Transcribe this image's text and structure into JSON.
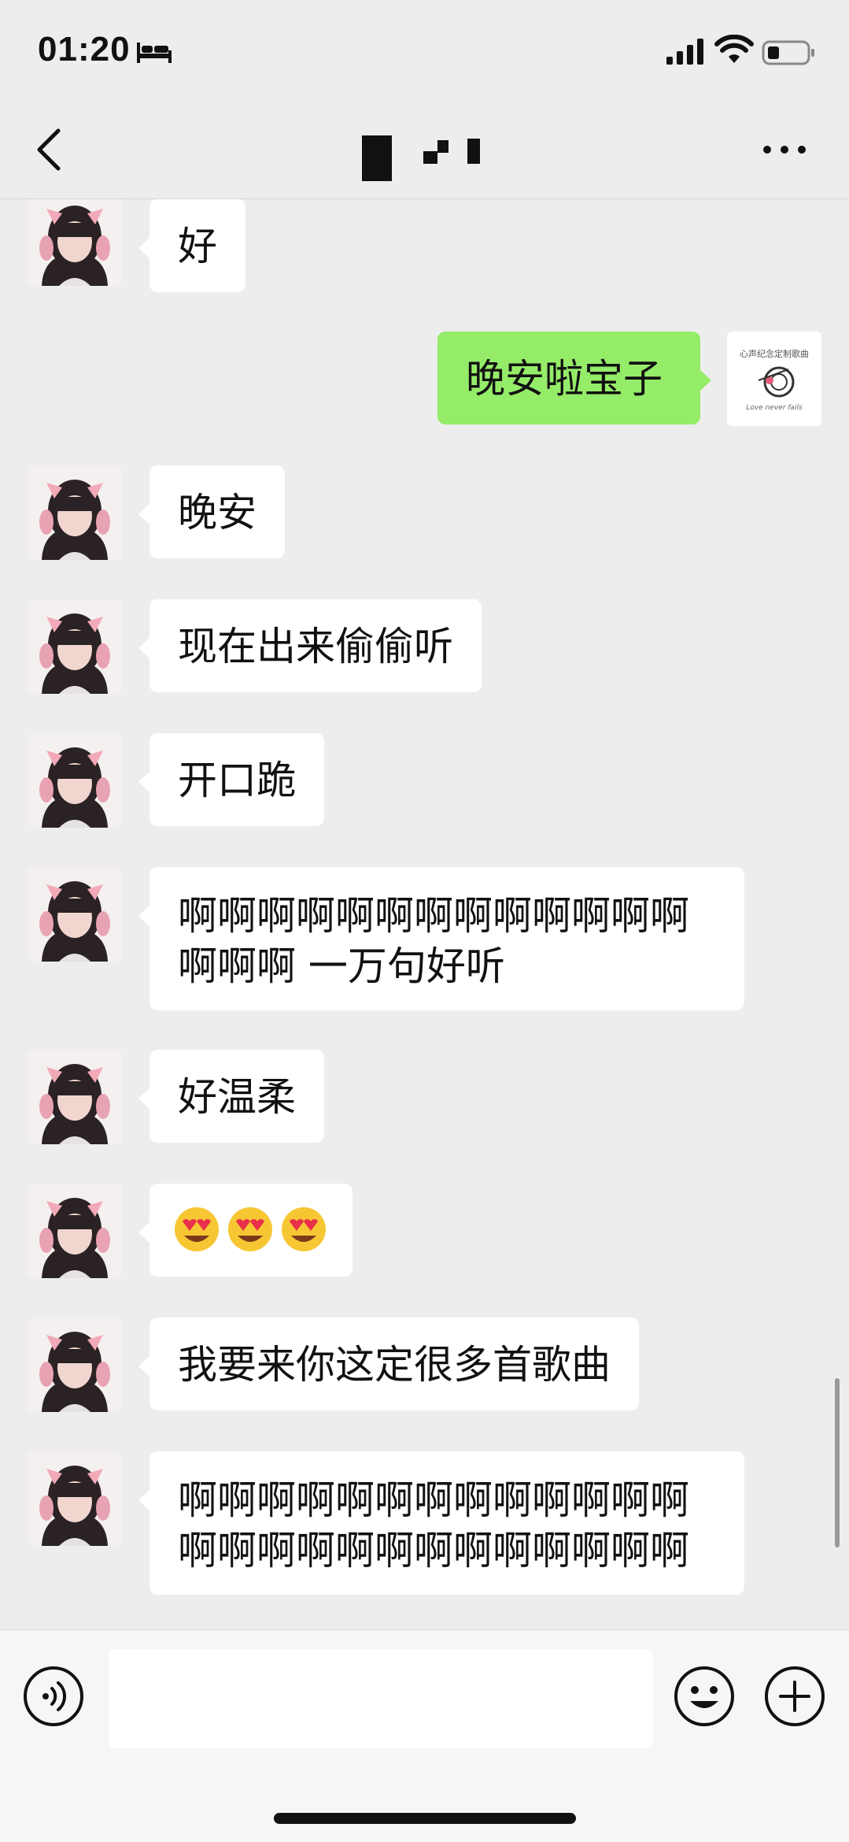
{
  "status_bar": {
    "time": "01:20",
    "icons": [
      "bed-icon",
      "signal-icon",
      "wifi-icon",
      "battery-icon"
    ]
  },
  "nav": {
    "title": "",
    "back_icon": "chevron-left-icon",
    "more_icon": "more-dots-icon"
  },
  "colors": {
    "background": "#ededed",
    "own_bubble": "#95ec69",
    "other_bubble": "#ffffff",
    "input_bar": "#f6f6f6"
  },
  "messages": [
    {
      "sender": "other",
      "text": "好"
    },
    {
      "sender": "me",
      "text": "晚安啦宝子",
      "avatar_text": "心声纪念定制歌曲",
      "avatar_subtext": "Love never fails"
    },
    {
      "sender": "other",
      "text": "晚安"
    },
    {
      "sender": "other",
      "text": "现在出来偷偷听"
    },
    {
      "sender": "other",
      "text": "开口跪"
    },
    {
      "sender": "other",
      "text": "啊啊啊啊啊啊啊啊啊啊啊啊啊\n啊啊啊 一万句好听"
    },
    {
      "sender": "other",
      "text": "好温柔"
    },
    {
      "sender": "other",
      "text": "😍😍😍"
    },
    {
      "sender": "other",
      "text": "我要来你这定很多首歌曲"
    },
    {
      "sender": "other",
      "text": "啊啊啊啊啊啊啊啊啊啊啊啊啊\n啊啊啊啊啊啊啊啊啊啊啊啊啊"
    }
  ],
  "input": {
    "value": "",
    "voice_icon": "voice-icon",
    "emoji_icon": "emoji-icon",
    "plus_icon": "plus-icon"
  }
}
